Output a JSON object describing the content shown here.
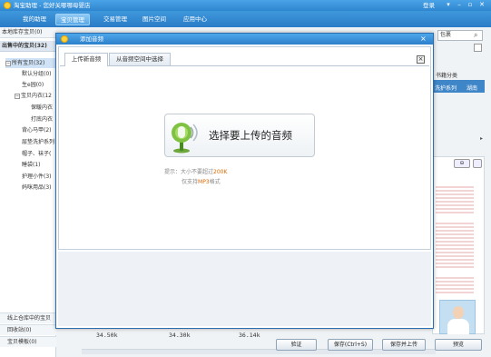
{
  "app": {
    "title": "淘宝助理 - 您好关哪哪母婴店",
    "user": "登录",
    "window_buttons": [
      "▾",
      "–",
      "▫",
      "✕"
    ]
  },
  "menu": [
    {
      "label": "我的助理",
      "active": false
    },
    {
      "label": "宝贝管理",
      "active": true
    },
    {
      "label": "交易管理",
      "active": false
    },
    {
      "label": "图片空间",
      "active": false
    },
    {
      "label": "应用中心",
      "active": false
    }
  ],
  "sidebar": {
    "local": "本地库存宝贝(0)",
    "on_sale": "出售中的宝贝(32)",
    "tree": [
      {
        "label": "所有宝贝(32)",
        "toggle": "−",
        "selected": true
      },
      {
        "label": "默认分组(0)"
      },
      {
        "label": "生e园(0)"
      },
      {
        "label": "宝贝内衣(12",
        "toggle": "−"
      },
      {
        "label": "保暖内衣"
      },
      {
        "label": "打底内衣"
      },
      {
        "label": "背心马甲(2)"
      },
      {
        "label": "层垫洗护系列"
      },
      {
        "label": "帽子、袜子("
      },
      {
        "label": "睡袋(1)"
      },
      {
        "label": "护理小件(3)"
      },
      {
        "label": "妈咪用品(3)"
      }
    ],
    "footer": [
      "线上仓库中的宝贝",
      "回收站(0)",
      "宝贝模板(0)"
    ]
  },
  "background": {
    "search_placeholder": "包裹",
    "col_category": "书籍分类",
    "col_series": "洗护系列",
    "col_region": "湖南",
    "sizes": [
      "34.50k",
      "34.30k",
      "36.14k"
    ],
    "zoom": "⊖"
  },
  "buttons": {
    "verify": "验证",
    "save": "保存(Ctrl+S)",
    "save_upload": "保存并上传",
    "preview": "预览"
  },
  "dialog": {
    "title": "添加音频",
    "close": "×",
    "tabs": [
      "上传新音频",
      "从音频空间中选择"
    ],
    "tab_close": "×",
    "upload_label": "选择要上传的音频",
    "hint_prefix": "提示：大小不要超过",
    "hint_size": "200K",
    "hint2_prefix": "仅支持",
    "hint2_format": "MP3",
    "hint2_suffix": "格式"
  },
  "colors": {
    "titlebar": "#2f86d0",
    "accent": "#4da6ea",
    "highlight": "#e06a00"
  }
}
